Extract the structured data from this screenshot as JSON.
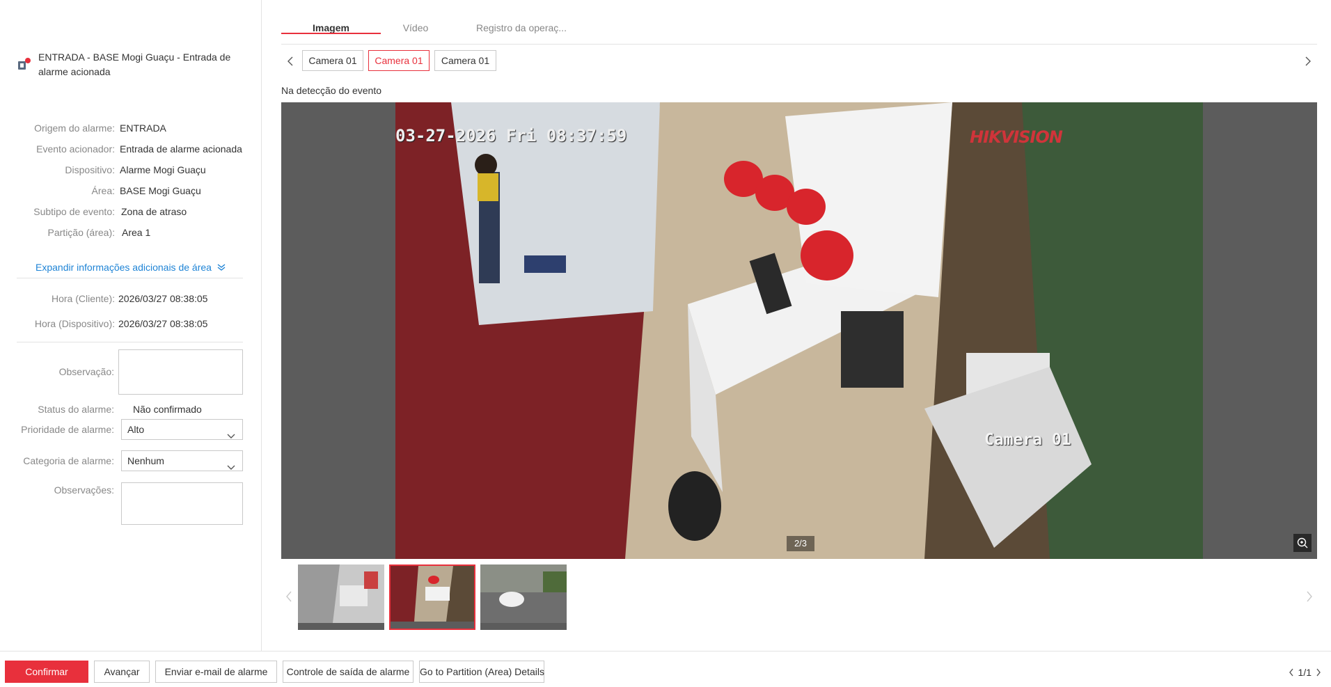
{
  "alarm": {
    "title": "ENTRADA - BASE Mogi Guaçu - Entrada de alarme acionada"
  },
  "details": [
    {
      "label": "Origem do alarme:",
      "value": "ENTRADA"
    },
    {
      "label": "Evento acionador:",
      "value": "Entrada de alarme acionada"
    },
    {
      "label": "Dispositivo:",
      "value": "Alarme Mogi Guaçu"
    },
    {
      "label": "Área:",
      "value": "BASE Mogi Guaçu"
    },
    {
      "label": "Subtipo de evento:",
      "value": "Zona de atraso"
    },
    {
      "label": "Partição (área):",
      "value": "Area 1"
    }
  ],
  "expand_link": "Expandir informações adicionais de área",
  "times": [
    {
      "label": "Hora (Cliente):",
      "value": "2026/03/27 08:38:05"
    },
    {
      "label": "Hora (Dispositivo):",
      "value": "2026/03/27 08:38:05"
    }
  ],
  "form": {
    "observation_label": "Observação:",
    "status_label": "Status do alarme:",
    "status_value": "Não confirmado",
    "priority_label": "Prioridade de alarme:",
    "priority_value": "Alto",
    "category_label": "Categoria de alarme:",
    "category_value": "Nenhum",
    "remarks_label": "Observações:"
  },
  "tabs": [
    "Imagem",
    "Vídeo",
    "Registro da operaç..."
  ],
  "cameras": [
    "Camera 01",
    "Camera 01",
    "Camera 01"
  ],
  "event_caption": "Na detecção do evento",
  "viewer": {
    "osd_time": "03-27-2026 Fri 08:37:59",
    "osd_brand": "HIKVISION",
    "osd_camera": "Camera 01",
    "page": "2/3"
  },
  "footer": {
    "confirm": "Confirmar",
    "next": "Avançar",
    "email": "Enviar e-mail de alarme",
    "output": "Controle de saída de alarme",
    "partition": "Go to Partition (Area) Details",
    "pager": "1/1"
  },
  "colors": {
    "accent": "#e8303c",
    "link": "#1f84d6"
  }
}
